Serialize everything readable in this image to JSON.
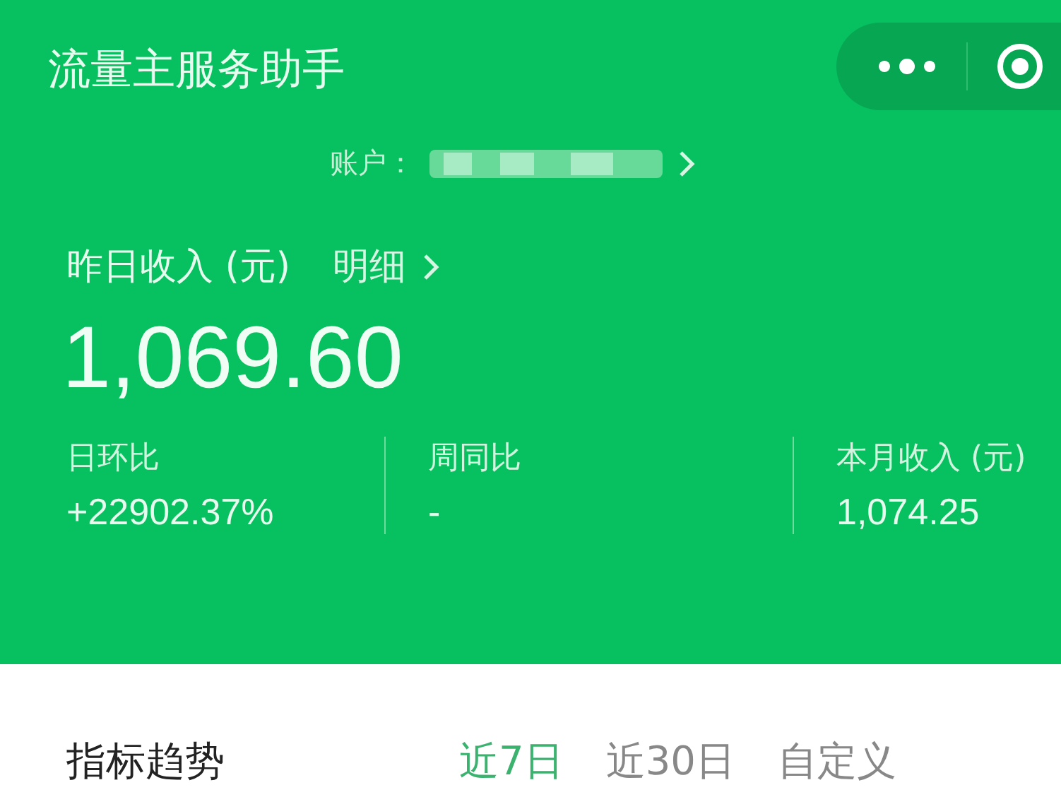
{
  "header": {
    "title": "流量主服务助手"
  },
  "account": {
    "label": "账户："
  },
  "income": {
    "label": "昨日收入 (元)",
    "detail_link": "明细",
    "amount": "1,069.60"
  },
  "stats": [
    {
      "label": "日环比",
      "value": "+22902.37%"
    },
    {
      "label": "周同比",
      "value": "-"
    },
    {
      "label": "本月收入 (元)",
      "value": "1,074.25"
    }
  ],
  "trend": {
    "title": "指标趋势",
    "tabs": [
      {
        "label": "近7日",
        "selected": true
      },
      {
        "label": "近30日",
        "selected": false
      },
      {
        "label": "自定义",
        "selected": false
      }
    ]
  }
}
